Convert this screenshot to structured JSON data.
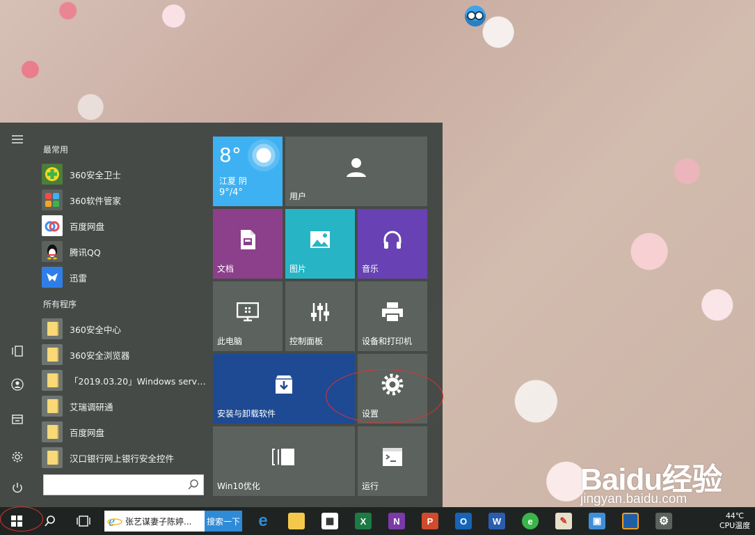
{
  "start_menu": {
    "most_used_label": "最常用",
    "most_used": [
      {
        "name": "360安全卫士",
        "icon": "360-safe-icon",
        "color": "#3bb54a"
      },
      {
        "name": "360软件管家",
        "icon": "360-software-icon",
        "color": "#f5a623"
      },
      {
        "name": "百度网盘",
        "icon": "baidu-netdisk-icon",
        "color": "#3b8ff0"
      },
      {
        "name": "腾讯QQ",
        "icon": "qq-penguin-icon",
        "color": "#222222"
      },
      {
        "name": "迅雷",
        "icon": "xunlei-bird-icon",
        "color": "#2f7ee8"
      }
    ],
    "all_programs_label": "所有程序",
    "all_programs": [
      {
        "name": "360安全中心"
      },
      {
        "name": "360安全浏览器"
      },
      {
        "name": "「2019.03.20」Windows server..."
      },
      {
        "name": "艾瑞调研通"
      },
      {
        "name": "百度网盘"
      },
      {
        "name": "汉口银行网上银行安全控件"
      }
    ],
    "search_placeholder": ""
  },
  "tiles": {
    "weather": {
      "temp": "8°",
      "location": "江夏  阴",
      "range": "9°/4°"
    },
    "user": "用户",
    "documents": "文档",
    "pictures": "图片",
    "music": "音乐",
    "this_pc": "此电脑",
    "control_panel": "控制面板",
    "devices_printers": "设备和打印机",
    "install_uninstall": "安装与卸载软件",
    "settings": "设置",
    "win10_optimize": "Win10优化",
    "run": "运行"
  },
  "taskbar": {
    "ie_text": "张艺谋妻子陈婷...",
    "search_button": "搜索一下",
    "tray_temp": "44℃",
    "tray_label": "CPU温度"
  },
  "watermark": {
    "logo": "Baidu经验",
    "url": "jingyan.baidu.com"
  },
  "colors": {
    "accent": "#3eb1f2",
    "annotation": "#dd3333"
  }
}
